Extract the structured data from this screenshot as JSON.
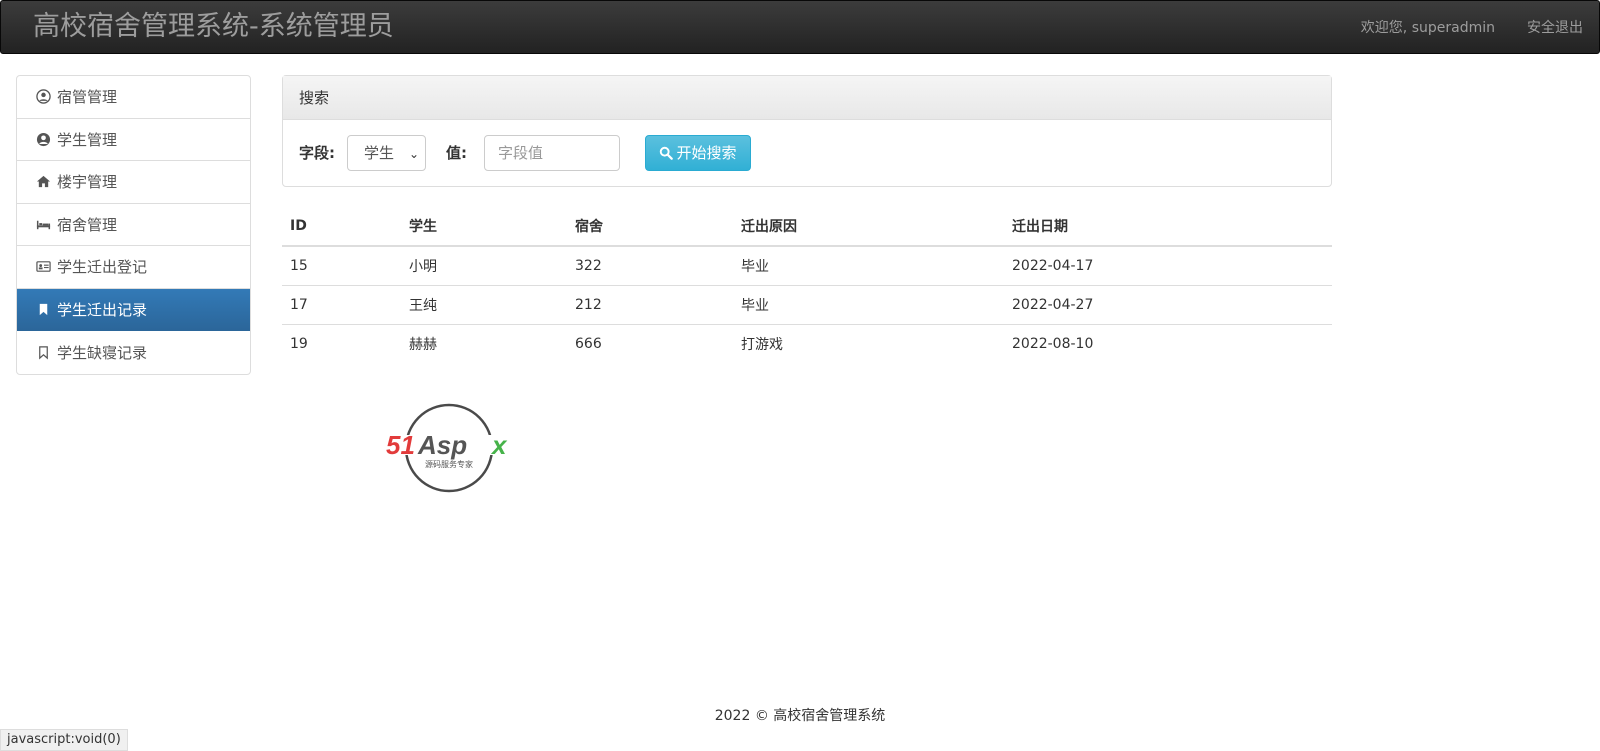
{
  "header": {
    "title": "高校宿舍管理系统-系统管理员",
    "welcome": "欢迎您, superadmin",
    "logout": "安全退出"
  },
  "sidebar": {
    "items": [
      {
        "label": "宿管管理",
        "icon": "user-circle-icon"
      },
      {
        "label": "学生管理",
        "icon": "user-circle-filled-icon"
      },
      {
        "label": "楼宇管理",
        "icon": "home-icon"
      },
      {
        "label": "宿舍管理",
        "icon": "bed-icon"
      },
      {
        "label": "学生迁出登记",
        "icon": "id-card-icon"
      },
      {
        "label": "学生迁出记录",
        "icon": "bookmark-filled-icon",
        "active": true
      },
      {
        "label": "学生缺寝记录",
        "icon": "bookmark-outline-icon"
      }
    ]
  },
  "search": {
    "panel_title": "搜索",
    "field_label": "字段:",
    "field_value": "学生",
    "value_label": "值:",
    "value_placeholder": "字段值",
    "button_label": "开始搜索"
  },
  "table": {
    "headers": [
      "ID",
      "学生",
      "宿舍",
      "迁出原因",
      "迁出日期"
    ],
    "rows": [
      [
        "15",
        "小明",
        "322",
        "毕业",
        "2022-04-17"
      ],
      [
        "17",
        "王纯",
        "212",
        "毕业",
        "2022-04-27"
      ],
      [
        "19",
        "赫赫",
        "666",
        "打游戏",
        "2022-08-10"
      ]
    ]
  },
  "logo": {
    "text": "51Aspx",
    "tagline": "源码服务专家"
  },
  "footer": {
    "text": "2022 © 高校宿舍管理系统"
  },
  "status_bar": {
    "text": "javascript:void(0)"
  }
}
